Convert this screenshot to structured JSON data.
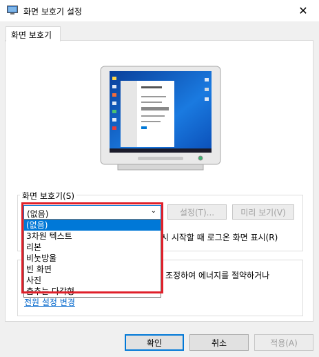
{
  "window": {
    "title": "화면 보호기 설정",
    "close_glyph": "✕"
  },
  "tab": {
    "label": "화면 보호기"
  },
  "screensaver_group": {
    "label": "화면 보호기(S)"
  },
  "combo": {
    "value": "(없음)",
    "arrow": "⌄"
  },
  "dropdown": {
    "items": [
      "(없음)",
      "3차원 텍스트",
      "리본",
      "비눗방울",
      "빈 화면",
      "사진",
      "춤추는 다각형"
    ],
    "selected_index": 0
  },
  "buttons": {
    "settings": "설정(T)...",
    "preview": "미리 보기(V)",
    "ok": "확인",
    "cancel": "취소",
    "apply": "적용(A)"
  },
  "partial_texts": {
    "resume": "시 시작할 때 로그온 화면 표시(R)",
    "power_desc": "조정하여 에너지를 절약하거나"
  },
  "power_link": "전원 설정 변경",
  "colors": {
    "highlight": "#e0202a",
    "selection": "#0078d7",
    "link": "#0066cc"
  }
}
